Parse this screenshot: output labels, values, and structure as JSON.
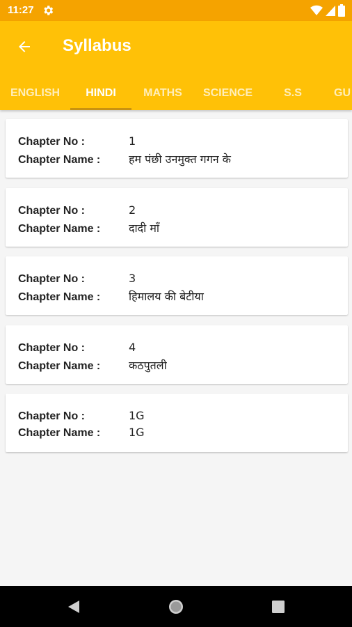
{
  "status": {
    "time": "11:27"
  },
  "app_bar": {
    "title": "Syllabus"
  },
  "tabs": [
    {
      "label": "ENGLISH"
    },
    {
      "label": "HINDI"
    },
    {
      "label": "MATHS"
    },
    {
      "label": "SCIENCE"
    },
    {
      "label": "S.S"
    },
    {
      "label": "GU"
    }
  ],
  "active_tab": "HINDI",
  "labels": {
    "chapter_no": "Chapter No :",
    "chapter_name": "Chapter Name :"
  },
  "chapters": [
    {
      "no": "1",
      "name": "हम पंछी उनमुक्त गगन के"
    },
    {
      "no": "2",
      "name": "दादी माँ"
    },
    {
      "no": "3",
      "name": "हिमालय की बेटीया"
    },
    {
      "no": "4",
      "name": "कठपुतली"
    },
    {
      "no": "1G",
      "name": "1G"
    }
  ],
  "colors": {
    "status_bar": "#f5a300",
    "app_bar": "#ffc107",
    "indicator": "#c99310"
  }
}
